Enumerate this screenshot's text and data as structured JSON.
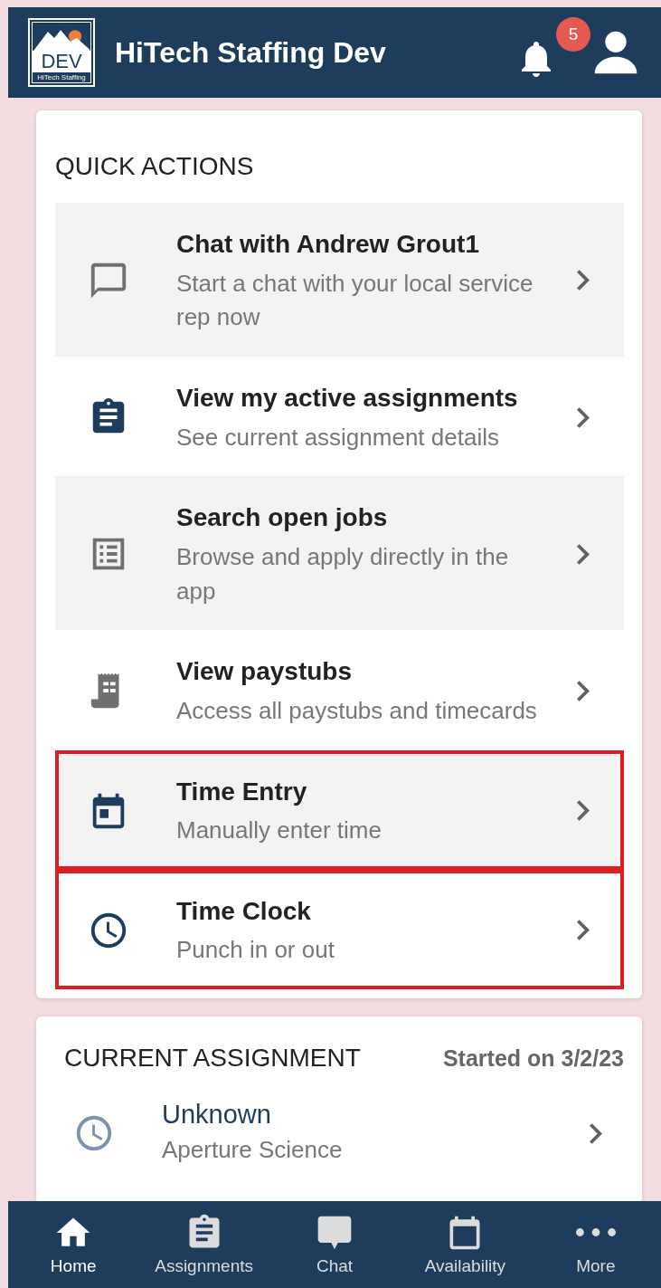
{
  "header": {
    "logo": {
      "text": "DEV",
      "subtext": "HiTech Staffing"
    },
    "title": "HiTech Staffing Dev",
    "notifications": {
      "count": "5"
    }
  },
  "quick_actions": {
    "title": "QUICK ACTIONS",
    "items": [
      {
        "title": "Chat with Andrew Grout1",
        "subtitle": "Start a chat with your local service rep now",
        "highlighted": false
      },
      {
        "title": "View my active assignments",
        "subtitle": "See current assignment details",
        "highlighted": false
      },
      {
        "title": "Search open jobs",
        "subtitle": "Browse and apply directly in the app",
        "highlighted": false
      },
      {
        "title": "View paystubs",
        "subtitle": "Access all paystubs and timecards",
        "highlighted": false
      },
      {
        "title": "Time Entry",
        "subtitle": "Manually enter time",
        "highlighted": true
      },
      {
        "title": "Time Clock",
        "subtitle": "Punch in or out",
        "highlighted": true
      }
    ]
  },
  "current_assignment": {
    "title": "CURRENT ASSIGNMENT",
    "started": "Started on 3/2/23",
    "item": {
      "title": "Unknown",
      "subtitle": "Aperture Science"
    }
  },
  "bottom_nav": [
    {
      "label": "Home",
      "selected": true
    },
    {
      "label": "Assignments",
      "selected": false
    },
    {
      "label": "Chat",
      "selected": false
    },
    {
      "label": "Availability",
      "selected": false
    },
    {
      "label": "More",
      "selected": false
    }
  ]
}
